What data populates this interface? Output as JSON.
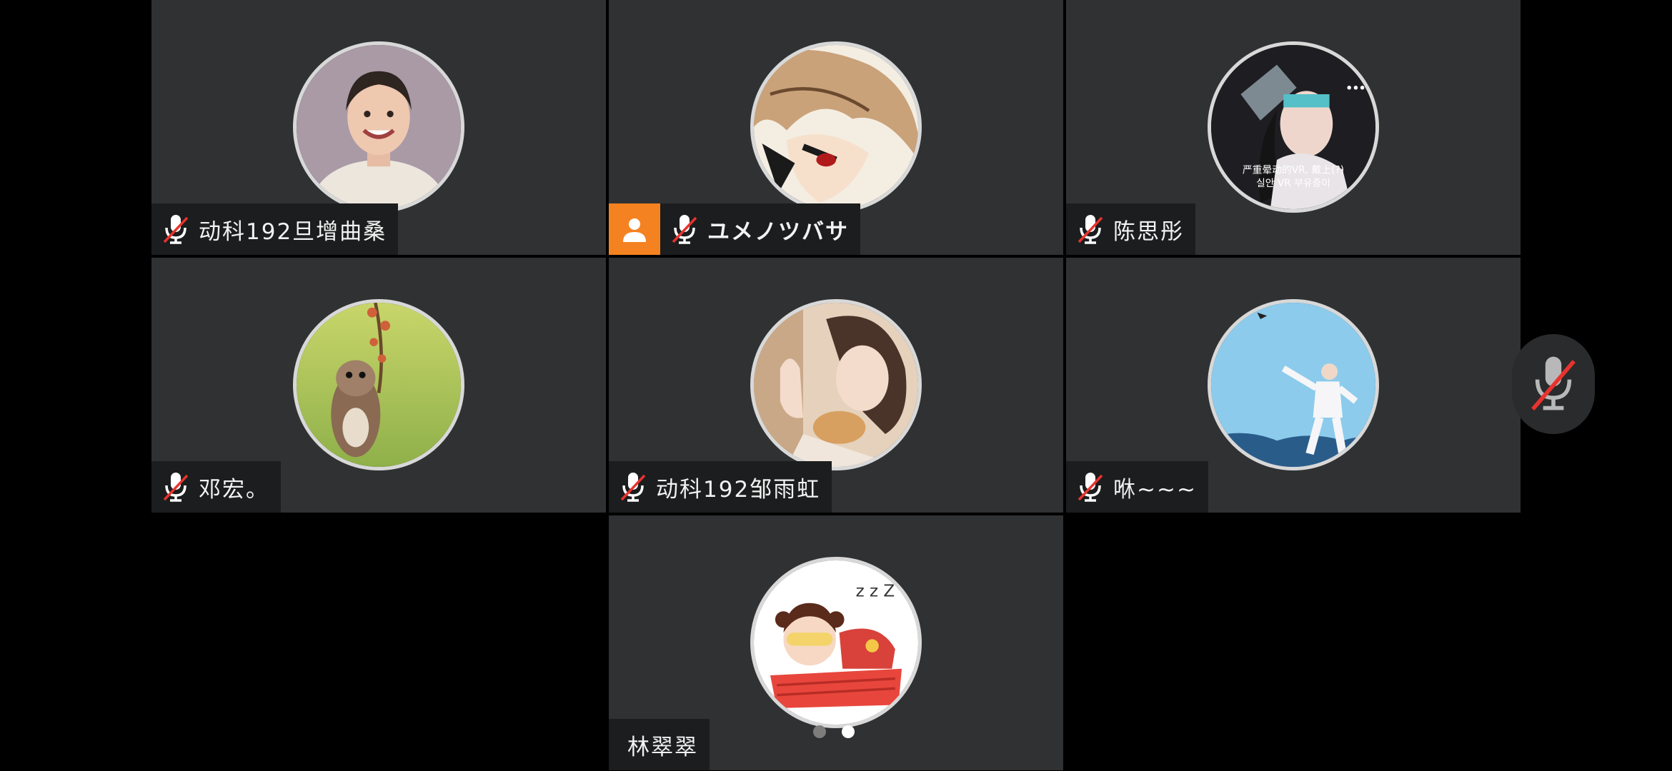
{
  "participants": [
    {
      "name": "动科192旦增曲桑",
      "muted": true,
      "host": false,
      "avatar": "photo-smiling-woman"
    },
    {
      "name": "ユメノツバサ",
      "muted": true,
      "host": true,
      "avatar": "anime-boy"
    },
    {
      "name": "陈思彤",
      "muted": true,
      "host": false,
      "avatar": "photo-girl-vr",
      "avatar_caption_1": "严重晕动的VR, 戴上(?)",
      "avatar_caption_2": "실안 VR 부유증이"
    },
    {
      "name": "邓宏。",
      "muted": true,
      "host": false,
      "avatar": "hamster"
    },
    {
      "name": "动科192邹雨虹",
      "muted": true,
      "host": false,
      "avatar": "photo-woman-with-cat"
    },
    {
      "name": "咻~~~",
      "muted": true,
      "host": false,
      "avatar": "dancer-blue-sky"
    },
    {
      "name": "林翠翠",
      "muted": false,
      "host": false,
      "avatar": "cartoon-girl-sleeping"
    }
  ],
  "controls": {
    "self_mic_muted": true
  },
  "pagination": {
    "pages": 2,
    "current": 2
  },
  "colors": {
    "tile_bg": "#303132",
    "host_badge": "#f58220",
    "mute_slash": "#e8332e"
  }
}
